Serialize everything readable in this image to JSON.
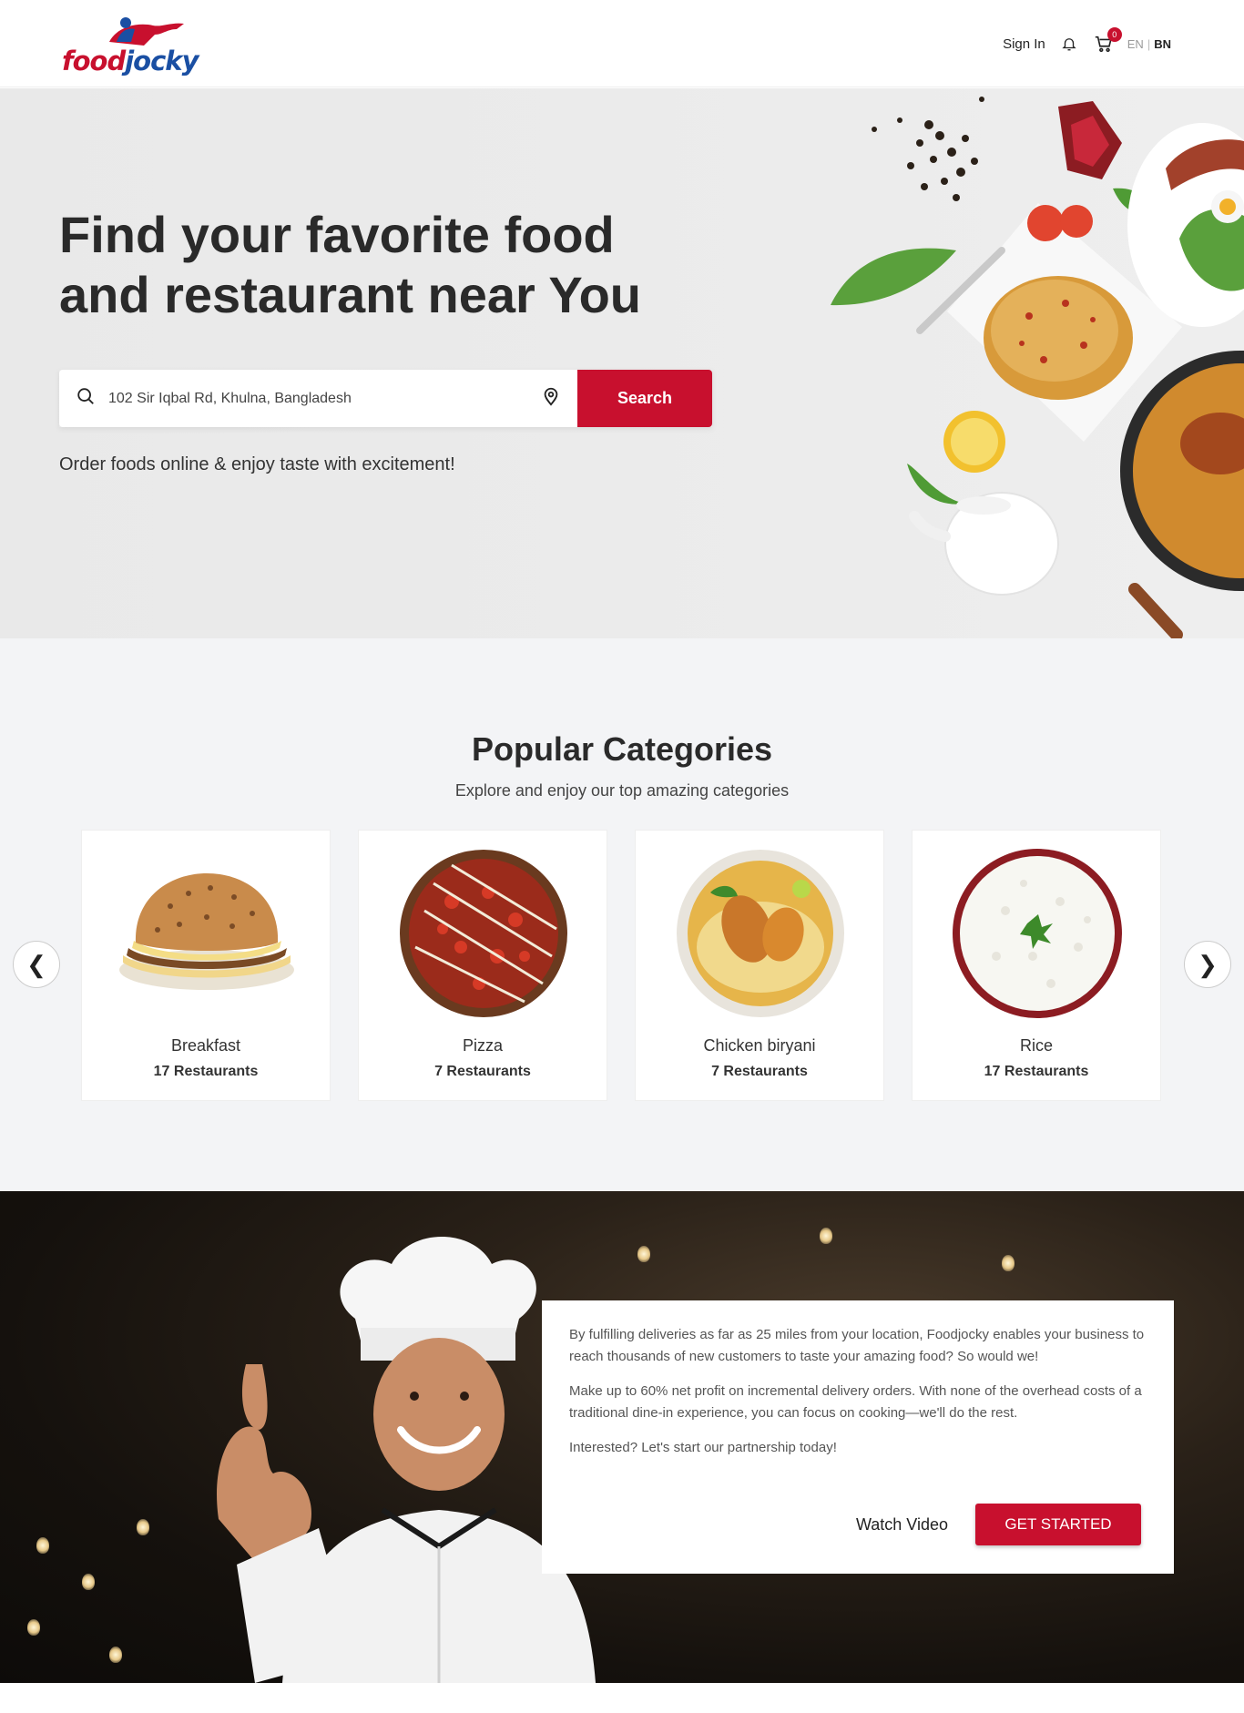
{
  "header": {
    "logo_food": "food",
    "logo_jocky": "jocky",
    "sign_in": "Sign In",
    "cart_count": "0",
    "lang_en": "EN",
    "lang_sep": "|",
    "lang_bn": "BN"
  },
  "hero": {
    "title": "Find your favorite food and restaurant near You",
    "search_value": "102 Sir Iqbal Rd, Khulna, Bangladesh",
    "search_button": "Search",
    "subtitle": "Order foods online & enjoy taste with excitement!"
  },
  "categories": {
    "title": "Popular Categories",
    "subtitle": "Explore and enjoy our top amazing categories",
    "prev_arrow": "❮",
    "next_arrow": "❯",
    "items": [
      {
        "name": "Breakfast",
        "count": "17 Restaurants",
        "icon": "burger-image"
      },
      {
        "name": "Pizza",
        "count": "7 Restaurants",
        "icon": "pizza-image"
      },
      {
        "name": "Chicken biryani",
        "count": "7 Restaurants",
        "icon": "biryani-image"
      },
      {
        "name": "Rice",
        "count": "17 Restaurants",
        "icon": "rice-image"
      }
    ]
  },
  "partner": {
    "p1": "By fulfilling deliveries as far as 25 miles from your location, Foodjocky enables your business to reach thousands of new customers to taste your amazing food? So would we!",
    "p2": "Make up to 60% net profit on incremental delivery orders. With none of the overhead costs of a traditional dine-in experience, you can focus on cooking—we'll do the rest.",
    "p3": "Interested? Let's start our partnership today!",
    "watch_video": "Watch Video",
    "get_started": "GET STARTED"
  },
  "colors": {
    "brand_red": "#c8102e",
    "brand_blue": "#1a4fa3"
  }
}
